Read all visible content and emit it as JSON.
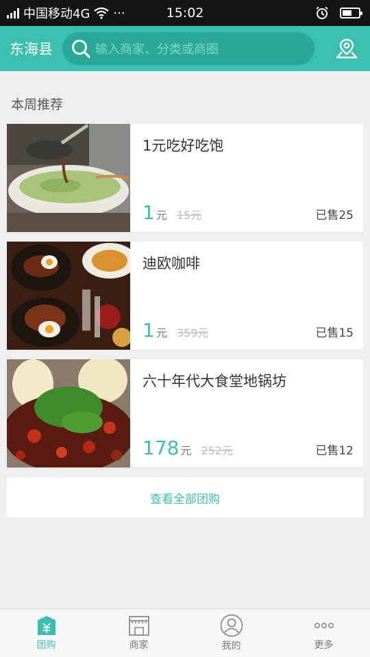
{
  "status_bar": {
    "carrier": "中国移动4G",
    "more": "···",
    "time": "15:02"
  },
  "header": {
    "city": "东海县",
    "search_placeholder": "输入商家、分类或商圈"
  },
  "section": {
    "title": "本周推荐"
  },
  "deals": [
    {
      "name": "1元吃好吃饱",
      "price": "1",
      "unit": "元",
      "original": "15元",
      "sold": "已售25"
    },
    {
      "name": "迪欧咖啡",
      "price": "1",
      "unit": "元",
      "original": "359元",
      "sold": "已售15"
    },
    {
      "name": "六十年代大食堂地锅坊",
      "price": "178",
      "unit": "元",
      "original": "252元",
      "sold": "已售12"
    }
  ],
  "view_all": "查看全部团购",
  "tabs": [
    {
      "label": "团购",
      "icon": "group-buy-icon",
      "active": true
    },
    {
      "label": "商家",
      "icon": "store-icon",
      "active": false
    },
    {
      "label": "我的",
      "icon": "profile-icon",
      "active": false
    },
    {
      "label": "更多",
      "icon": "more-icon",
      "active": false
    }
  ],
  "colors": {
    "accent": "#3cbfae",
    "search_bg": "#2aa897",
    "status_bg": "#141414",
    "page_bg": "#efefef"
  }
}
